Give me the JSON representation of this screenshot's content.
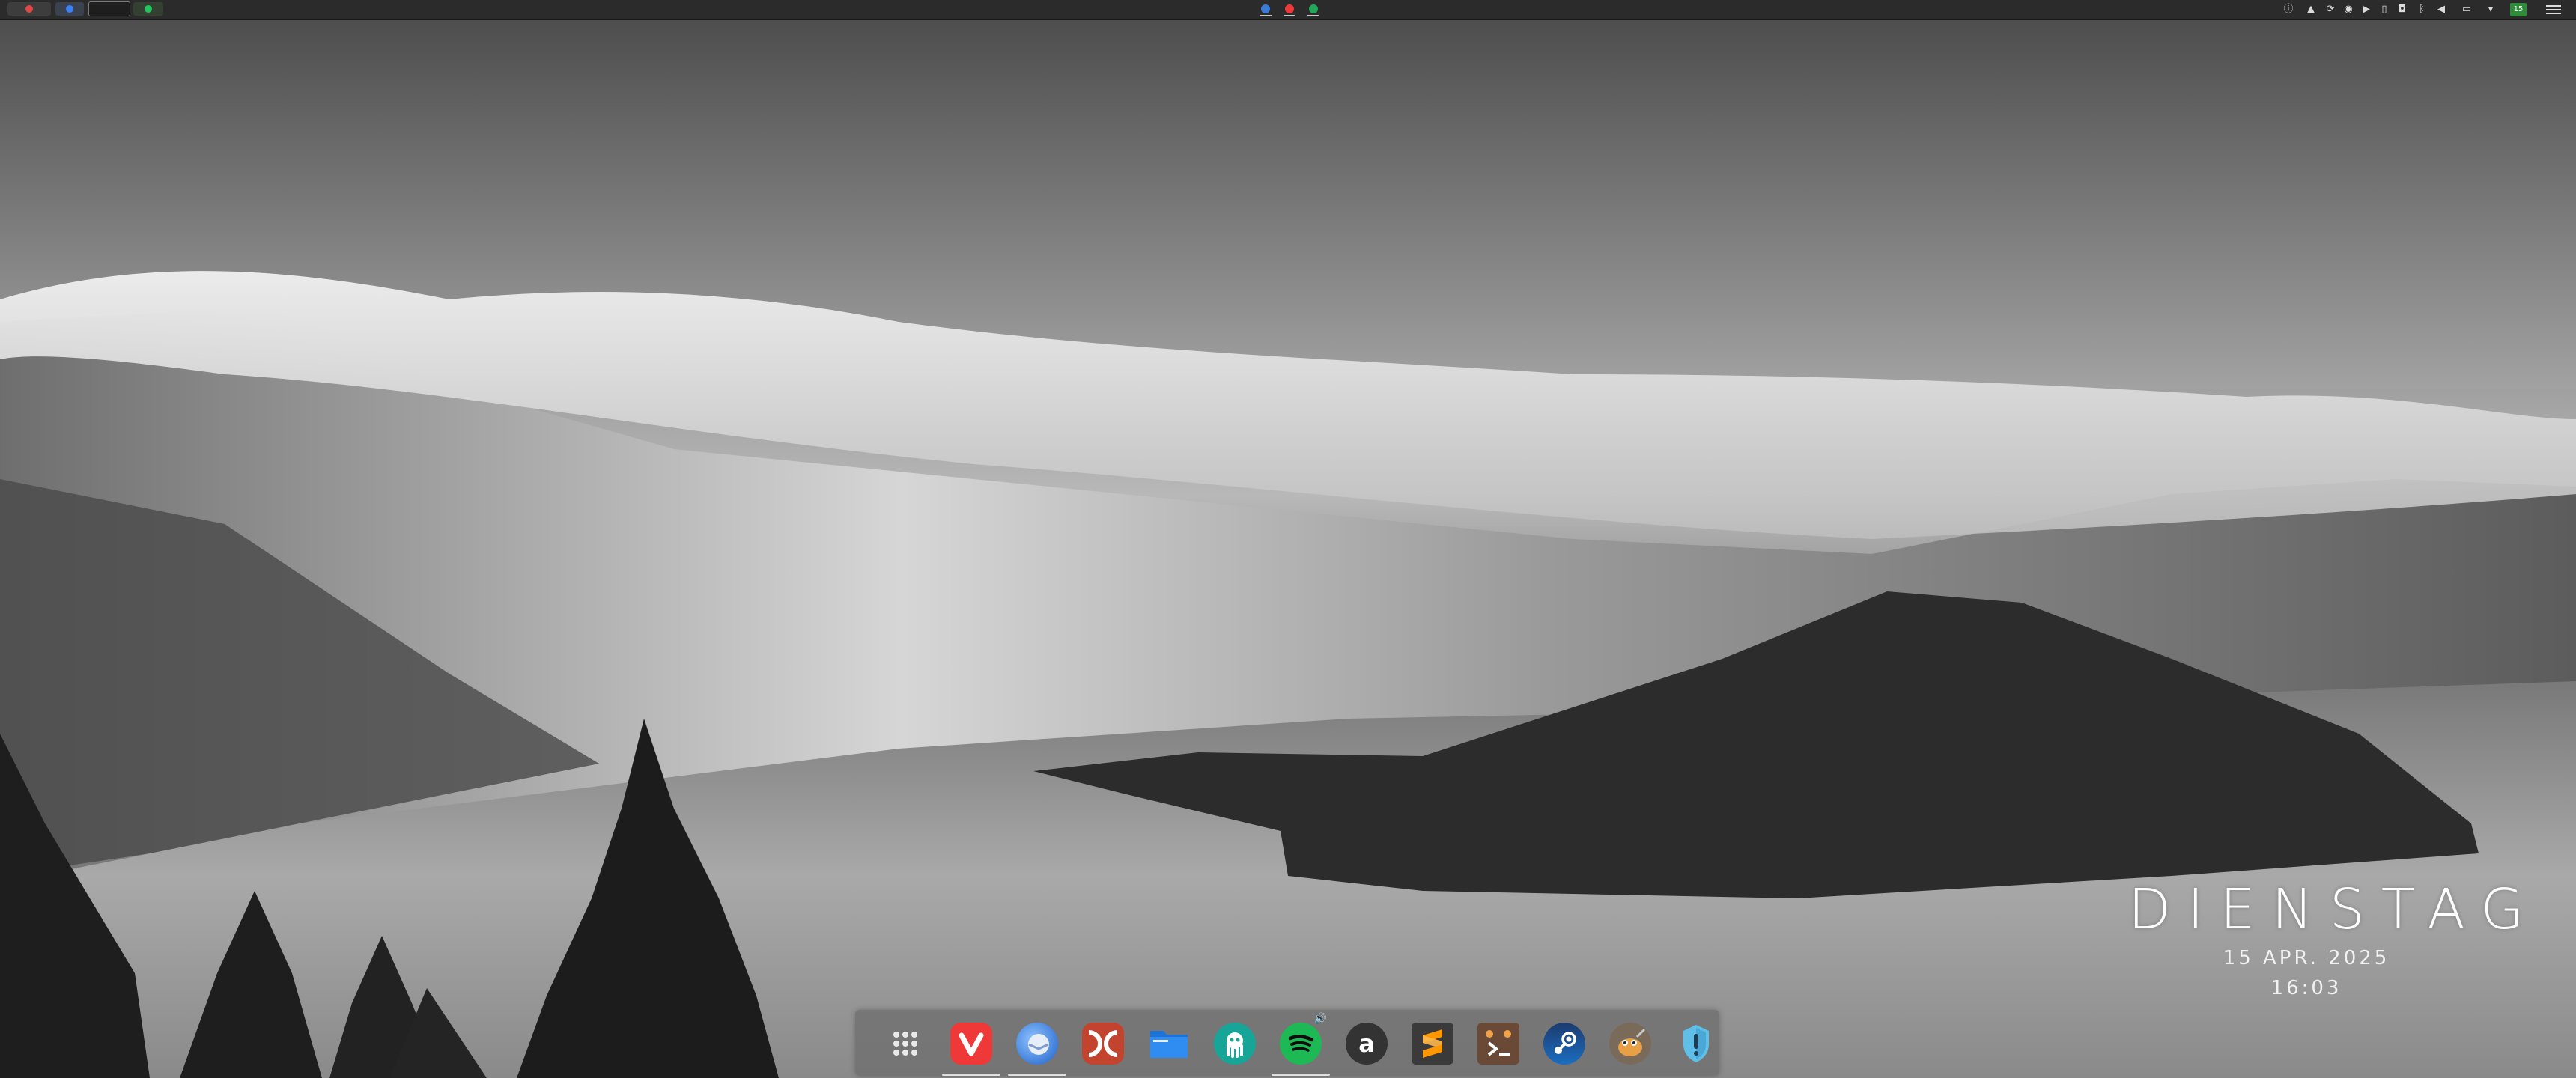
{
  "top_panel": {
    "workspaces": [
      {
        "name": "workspace-1",
        "active": false
      },
      {
        "name": "workspace-2",
        "active": false
      },
      {
        "name": "workspace-3",
        "active": true
      },
      {
        "name": "workspace-4",
        "active": false
      }
    ],
    "center_apps": [
      "browser-app-icon",
      "vivaldi-app-icon",
      "chrome-app-icon"
    ],
    "tray_icons": [
      "info-icon",
      "arch-icon",
      "sync-icon",
      "chat-icon",
      "media-icon",
      "clipboard-icon",
      "bluetooth-icon",
      "volume-icon",
      "display-icon",
      "dropdown-icon"
    ],
    "calendar_badge": "15"
  },
  "clock_widget": {
    "day_name": "DIENSTAG",
    "date": "15 APR. 2025",
    "time": "16:03"
  },
  "dock": {
    "items": [
      {
        "name": "app-grid-icon",
        "running": false
      },
      {
        "name": "vivaldi-icon",
        "running": true
      },
      {
        "name": "thunderbird-icon",
        "running": true
      },
      {
        "name": "double-commander-icon",
        "running": false
      },
      {
        "name": "files-icon",
        "running": false
      },
      {
        "name": "gitkraken-icon",
        "running": false
      },
      {
        "name": "spotify-icon",
        "running": true
      },
      {
        "name": "amazon-icon",
        "running": false
      },
      {
        "name": "sublime-text-icon",
        "running": false
      },
      {
        "name": "terminal-icon",
        "running": false
      },
      {
        "name": "steam-icon",
        "running": false
      },
      {
        "name": "gimp-icon",
        "running": false
      },
      {
        "name": "proton-vpn-icon",
        "running": false
      }
    ],
    "amazon_glyph": "a"
  },
  "colors": {
    "panel_bg": "#2b2b2b",
    "dock_bg": "#6e6e6e",
    "vivaldi": "#ef3939",
    "spotify": "#1db954",
    "sublime": "#ff9800",
    "steam": "#1b4f8a"
  }
}
